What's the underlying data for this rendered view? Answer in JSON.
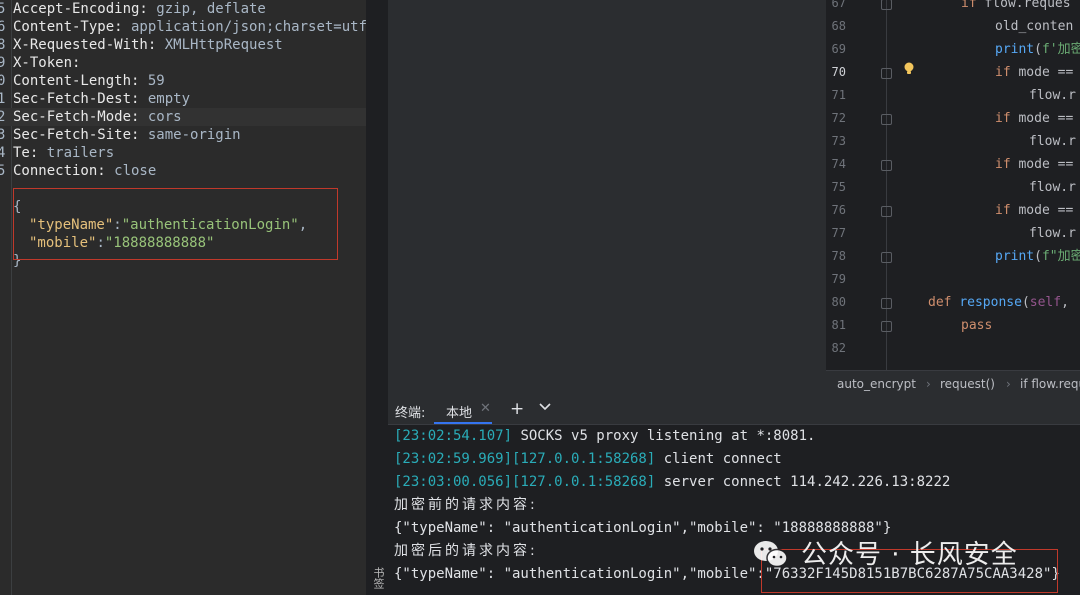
{
  "request": {
    "header_lines": [
      {
        "ln": "5",
        "key": "Accept-Encoding:",
        "val": " gzip, deflate"
      },
      {
        "ln": "6",
        "key": "Content-Type:",
        "val": " application/json;charset=utf"
      },
      {
        "ln": "8",
        "key": "X-Requested-With:",
        "val": " XMLHttpRequest"
      },
      {
        "ln": "9",
        "key": "X-Token:",
        "val": ""
      },
      {
        "ln": "0",
        "key": "Content-Length:",
        "val": " 59"
      },
      {
        "ln": "1",
        "key": "Sec-Fetch-Dest:",
        "val": " empty"
      },
      {
        "ln": "2",
        "key": "Sec-Fetch-Mode:",
        "val": " cors"
      },
      {
        "ln": "3",
        "key": "Sec-Fetch-Site:",
        "val": " same-origin"
      },
      {
        "ln": "4",
        "key": "Te:",
        "val": " trailers"
      },
      {
        "ln": "5",
        "key": "Connection:",
        "val": " close"
      }
    ],
    "body": {
      "open": "{",
      "k1": "\"typeName\"",
      "colon1": ":",
      "v1": "\"authenticationLogin\"",
      "comma1": ",",
      "k2": "\"mobile\"",
      "colon2": ":",
      "v2": "\"18888888888\"",
      "close": "}"
    }
  },
  "editor": {
    "lines": [
      {
        "n": "67",
        "parts": [
          [
            "kw",
            "if "
          ],
          [
            "",
            "flow.reques"
          ]
        ]
      },
      {
        "n": "68",
        "parts": [
          [
            "",
            "old_conten"
          ]
        ]
      },
      {
        "n": "69",
        "parts": [
          [
            "fn",
            "print"
          ],
          [
            "",
            "("
          ],
          [
            "str",
            "f'加密"
          ]
        ]
      },
      {
        "n": "70",
        "parts": [
          [
            "kw",
            "if "
          ],
          [
            "",
            "mode =="
          ]
        ]
      },
      {
        "n": "71",
        "parts": [
          [
            "",
            "flow.r"
          ]
        ]
      },
      {
        "n": "72",
        "parts": [
          [
            "kw",
            "if "
          ],
          [
            "",
            "mode =="
          ]
        ]
      },
      {
        "n": "73",
        "parts": [
          [
            "",
            "flow.r"
          ]
        ]
      },
      {
        "n": "74",
        "parts": [
          [
            "kw",
            "if "
          ],
          [
            "",
            "mode =="
          ]
        ]
      },
      {
        "n": "75",
        "parts": [
          [
            "",
            "flow.r"
          ]
        ]
      },
      {
        "n": "76",
        "parts": [
          [
            "kw",
            "if "
          ],
          [
            "",
            "mode =="
          ]
        ]
      },
      {
        "n": "77",
        "parts": [
          [
            "",
            "flow.r"
          ]
        ]
      },
      {
        "n": "78",
        "parts": [
          [
            "fn",
            "print"
          ],
          [
            "",
            "("
          ],
          [
            "str",
            "f\"加密"
          ]
        ]
      },
      {
        "n": "79",
        "parts": []
      },
      {
        "n": "80",
        "parts": [
          [
            "kw",
            "def "
          ],
          [
            "fn",
            "response"
          ],
          [
            "",
            "("
          ],
          [
            "prm",
            "self"
          ],
          [
            "",
            ","
          ]
        ]
      },
      {
        "n": "81",
        "parts": [
          [
            "kw",
            "pass"
          ]
        ]
      },
      {
        "n": "82",
        "parts": []
      }
    ],
    "breadcrumb": [
      "auto_encrypt",
      "request()",
      "if flow.requ"
    ]
  },
  "terminal": {
    "title": "终端:",
    "tab_label": "本地",
    "tab_close": "✕",
    "add": "+",
    "lines": [
      {
        "ts": "[23:02:54.107]",
        "rest": " SOCKS v5 proxy listening at *:8081."
      },
      {
        "ts": "[23:02:59.969][127.0.0.1:58268]",
        "rest": " client connect"
      },
      {
        "ts": "[23:03:00.056][127.0.0.1:58268]",
        "rest": " server connect 114.242.226.13:8222"
      },
      {
        "ts": "",
        "rest": "加密前的请求内容:"
      },
      {
        "ts": "",
        "rest": "{\"typeName\": \"authenticationLogin\",\"mobile\": \"18888888888\"}"
      },
      {
        "ts": "",
        "rest": "加密后的请求内容:"
      },
      {
        "ts": "",
        "rest": "{\"typeName\": \"authenticationLogin\",\"mobile\":\"76332F145D8151B7BC6287A75CAA3428\"}"
      }
    ]
  },
  "side_tab": "书签",
  "watermark": "公众号 · 长风安全",
  "colors": {
    "accent": "#3574f0",
    "highlight_box": "#c0392b"
  }
}
